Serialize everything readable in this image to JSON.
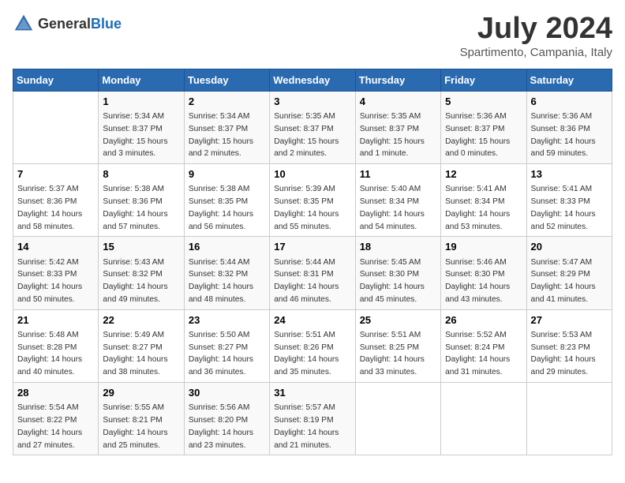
{
  "header": {
    "logo_general": "General",
    "logo_blue": "Blue",
    "month": "July 2024",
    "location": "Spartimento, Campania, Italy"
  },
  "weekdays": [
    "Sunday",
    "Monday",
    "Tuesday",
    "Wednesday",
    "Thursday",
    "Friday",
    "Saturday"
  ],
  "weeks": [
    [
      {
        "day": "",
        "sunrise": "",
        "sunset": "",
        "daylight": ""
      },
      {
        "day": "1",
        "sunrise": "Sunrise: 5:34 AM",
        "sunset": "Sunset: 8:37 PM",
        "daylight": "Daylight: 15 hours and 3 minutes."
      },
      {
        "day": "2",
        "sunrise": "Sunrise: 5:34 AM",
        "sunset": "Sunset: 8:37 PM",
        "daylight": "Daylight: 15 hours and 2 minutes."
      },
      {
        "day": "3",
        "sunrise": "Sunrise: 5:35 AM",
        "sunset": "Sunset: 8:37 PM",
        "daylight": "Daylight: 15 hours and 2 minutes."
      },
      {
        "day": "4",
        "sunrise": "Sunrise: 5:35 AM",
        "sunset": "Sunset: 8:37 PM",
        "daylight": "Daylight: 15 hours and 1 minute."
      },
      {
        "day": "5",
        "sunrise": "Sunrise: 5:36 AM",
        "sunset": "Sunset: 8:37 PM",
        "daylight": "Daylight: 15 hours and 0 minutes."
      },
      {
        "day": "6",
        "sunrise": "Sunrise: 5:36 AM",
        "sunset": "Sunset: 8:36 PM",
        "daylight": "Daylight: 14 hours and 59 minutes."
      }
    ],
    [
      {
        "day": "7",
        "sunrise": "Sunrise: 5:37 AM",
        "sunset": "Sunset: 8:36 PM",
        "daylight": "Daylight: 14 hours and 58 minutes."
      },
      {
        "day": "8",
        "sunrise": "Sunrise: 5:38 AM",
        "sunset": "Sunset: 8:36 PM",
        "daylight": "Daylight: 14 hours and 57 minutes."
      },
      {
        "day": "9",
        "sunrise": "Sunrise: 5:38 AM",
        "sunset": "Sunset: 8:35 PM",
        "daylight": "Daylight: 14 hours and 56 minutes."
      },
      {
        "day": "10",
        "sunrise": "Sunrise: 5:39 AM",
        "sunset": "Sunset: 8:35 PM",
        "daylight": "Daylight: 14 hours and 55 minutes."
      },
      {
        "day": "11",
        "sunrise": "Sunrise: 5:40 AM",
        "sunset": "Sunset: 8:34 PM",
        "daylight": "Daylight: 14 hours and 54 minutes."
      },
      {
        "day": "12",
        "sunrise": "Sunrise: 5:41 AM",
        "sunset": "Sunset: 8:34 PM",
        "daylight": "Daylight: 14 hours and 53 minutes."
      },
      {
        "day": "13",
        "sunrise": "Sunrise: 5:41 AM",
        "sunset": "Sunset: 8:33 PM",
        "daylight": "Daylight: 14 hours and 52 minutes."
      }
    ],
    [
      {
        "day": "14",
        "sunrise": "Sunrise: 5:42 AM",
        "sunset": "Sunset: 8:33 PM",
        "daylight": "Daylight: 14 hours and 50 minutes."
      },
      {
        "day": "15",
        "sunrise": "Sunrise: 5:43 AM",
        "sunset": "Sunset: 8:32 PM",
        "daylight": "Daylight: 14 hours and 49 minutes."
      },
      {
        "day": "16",
        "sunrise": "Sunrise: 5:44 AM",
        "sunset": "Sunset: 8:32 PM",
        "daylight": "Daylight: 14 hours and 48 minutes."
      },
      {
        "day": "17",
        "sunrise": "Sunrise: 5:44 AM",
        "sunset": "Sunset: 8:31 PM",
        "daylight": "Daylight: 14 hours and 46 minutes."
      },
      {
        "day": "18",
        "sunrise": "Sunrise: 5:45 AM",
        "sunset": "Sunset: 8:30 PM",
        "daylight": "Daylight: 14 hours and 45 minutes."
      },
      {
        "day": "19",
        "sunrise": "Sunrise: 5:46 AM",
        "sunset": "Sunset: 8:30 PM",
        "daylight": "Daylight: 14 hours and 43 minutes."
      },
      {
        "day": "20",
        "sunrise": "Sunrise: 5:47 AM",
        "sunset": "Sunset: 8:29 PM",
        "daylight": "Daylight: 14 hours and 41 minutes."
      }
    ],
    [
      {
        "day": "21",
        "sunrise": "Sunrise: 5:48 AM",
        "sunset": "Sunset: 8:28 PM",
        "daylight": "Daylight: 14 hours and 40 minutes."
      },
      {
        "day": "22",
        "sunrise": "Sunrise: 5:49 AM",
        "sunset": "Sunset: 8:27 PM",
        "daylight": "Daylight: 14 hours and 38 minutes."
      },
      {
        "day": "23",
        "sunrise": "Sunrise: 5:50 AM",
        "sunset": "Sunset: 8:27 PM",
        "daylight": "Daylight: 14 hours and 36 minutes."
      },
      {
        "day": "24",
        "sunrise": "Sunrise: 5:51 AM",
        "sunset": "Sunset: 8:26 PM",
        "daylight": "Daylight: 14 hours and 35 minutes."
      },
      {
        "day": "25",
        "sunrise": "Sunrise: 5:51 AM",
        "sunset": "Sunset: 8:25 PM",
        "daylight": "Daylight: 14 hours and 33 minutes."
      },
      {
        "day": "26",
        "sunrise": "Sunrise: 5:52 AM",
        "sunset": "Sunset: 8:24 PM",
        "daylight": "Daylight: 14 hours and 31 minutes."
      },
      {
        "day": "27",
        "sunrise": "Sunrise: 5:53 AM",
        "sunset": "Sunset: 8:23 PM",
        "daylight": "Daylight: 14 hours and 29 minutes."
      }
    ],
    [
      {
        "day": "28",
        "sunrise": "Sunrise: 5:54 AM",
        "sunset": "Sunset: 8:22 PM",
        "daylight": "Daylight: 14 hours and 27 minutes."
      },
      {
        "day": "29",
        "sunrise": "Sunrise: 5:55 AM",
        "sunset": "Sunset: 8:21 PM",
        "daylight": "Daylight: 14 hours and 25 minutes."
      },
      {
        "day": "30",
        "sunrise": "Sunrise: 5:56 AM",
        "sunset": "Sunset: 8:20 PM",
        "daylight": "Daylight: 14 hours and 23 minutes."
      },
      {
        "day": "31",
        "sunrise": "Sunrise: 5:57 AM",
        "sunset": "Sunset: 8:19 PM",
        "daylight": "Daylight: 14 hours and 21 minutes."
      },
      {
        "day": "",
        "sunrise": "",
        "sunset": "",
        "daylight": ""
      },
      {
        "day": "",
        "sunrise": "",
        "sunset": "",
        "daylight": ""
      },
      {
        "day": "",
        "sunrise": "",
        "sunset": "",
        "daylight": ""
      }
    ]
  ]
}
